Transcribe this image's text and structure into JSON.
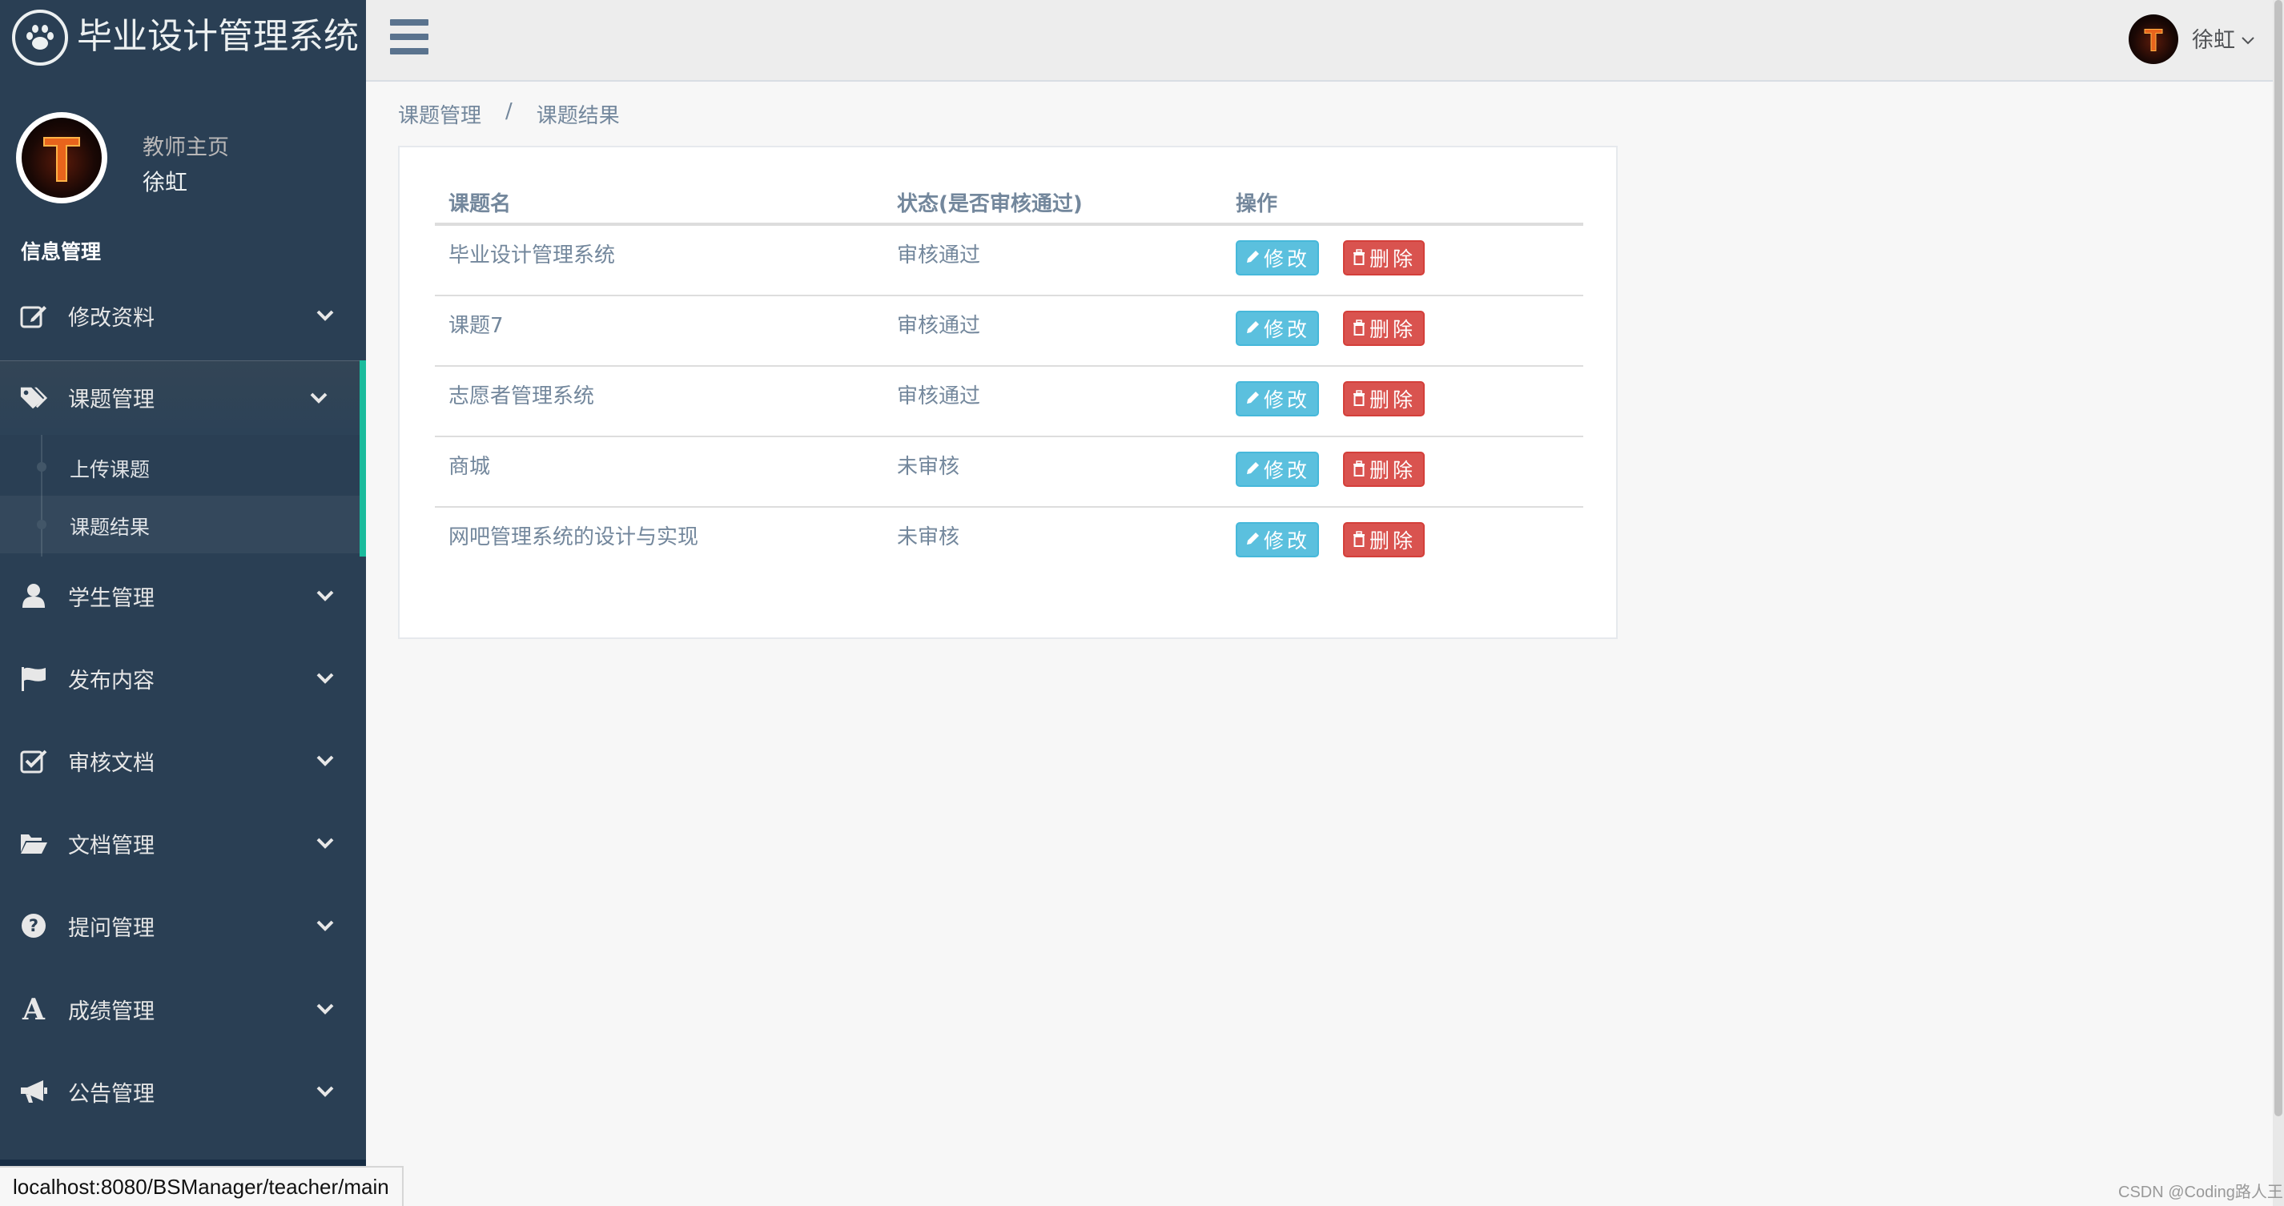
{
  "app": {
    "title": "毕业设计管理系统"
  },
  "profile": {
    "greeting": "教师主页",
    "name": "徐虹"
  },
  "sidebar": {
    "section_title": "信息管理",
    "items": [
      {
        "label": "修改资料",
        "icon": "edit-icon"
      },
      {
        "label": "课题管理",
        "icon": "tags-icon",
        "active": true,
        "children": [
          {
            "label": "上传课题"
          },
          {
            "label": "课题结果",
            "current": true
          }
        ]
      },
      {
        "label": "学生管理",
        "icon": "user-icon"
      },
      {
        "label": "发布内容",
        "icon": "flag-icon"
      },
      {
        "label": "审核文档",
        "icon": "check-square-icon"
      },
      {
        "label": "文档管理",
        "icon": "folder-open-icon"
      },
      {
        "label": "提问管理",
        "icon": "question-circle-icon"
      },
      {
        "label": "成绩管理",
        "icon": "font-icon"
      },
      {
        "label": "公告管理",
        "icon": "bullhorn-icon"
      }
    ]
  },
  "topnav": {
    "user_name": "徐虹"
  },
  "breadcrumb": {
    "parent": "课题管理",
    "separator": "/",
    "current": "课题结果"
  },
  "table": {
    "headers": [
      "课题名",
      "状态(是否审核通过)",
      "操作"
    ],
    "rows": [
      {
        "name": "毕业设计管理系统",
        "status": "审核通过"
      },
      {
        "name": "课题7",
        "status": "审核通过"
      },
      {
        "name": "志愿者管理系统",
        "status": "审核通过"
      },
      {
        "name": "商城",
        "status": "未审核"
      },
      {
        "name": "网吧管理系统的设计与实现",
        "status": "未审核"
      }
    ],
    "edit_label": "修改",
    "delete_label": "删除"
  },
  "statusbar": {
    "url": "localhost:8080/BSManager/teacher/main"
  },
  "watermark": "CSDN @Coding路人王",
  "colors": {
    "sidebar": "#2a3f54",
    "accent": "#1abb9c",
    "info": "#5bc0de",
    "danger": "#d9534f"
  }
}
